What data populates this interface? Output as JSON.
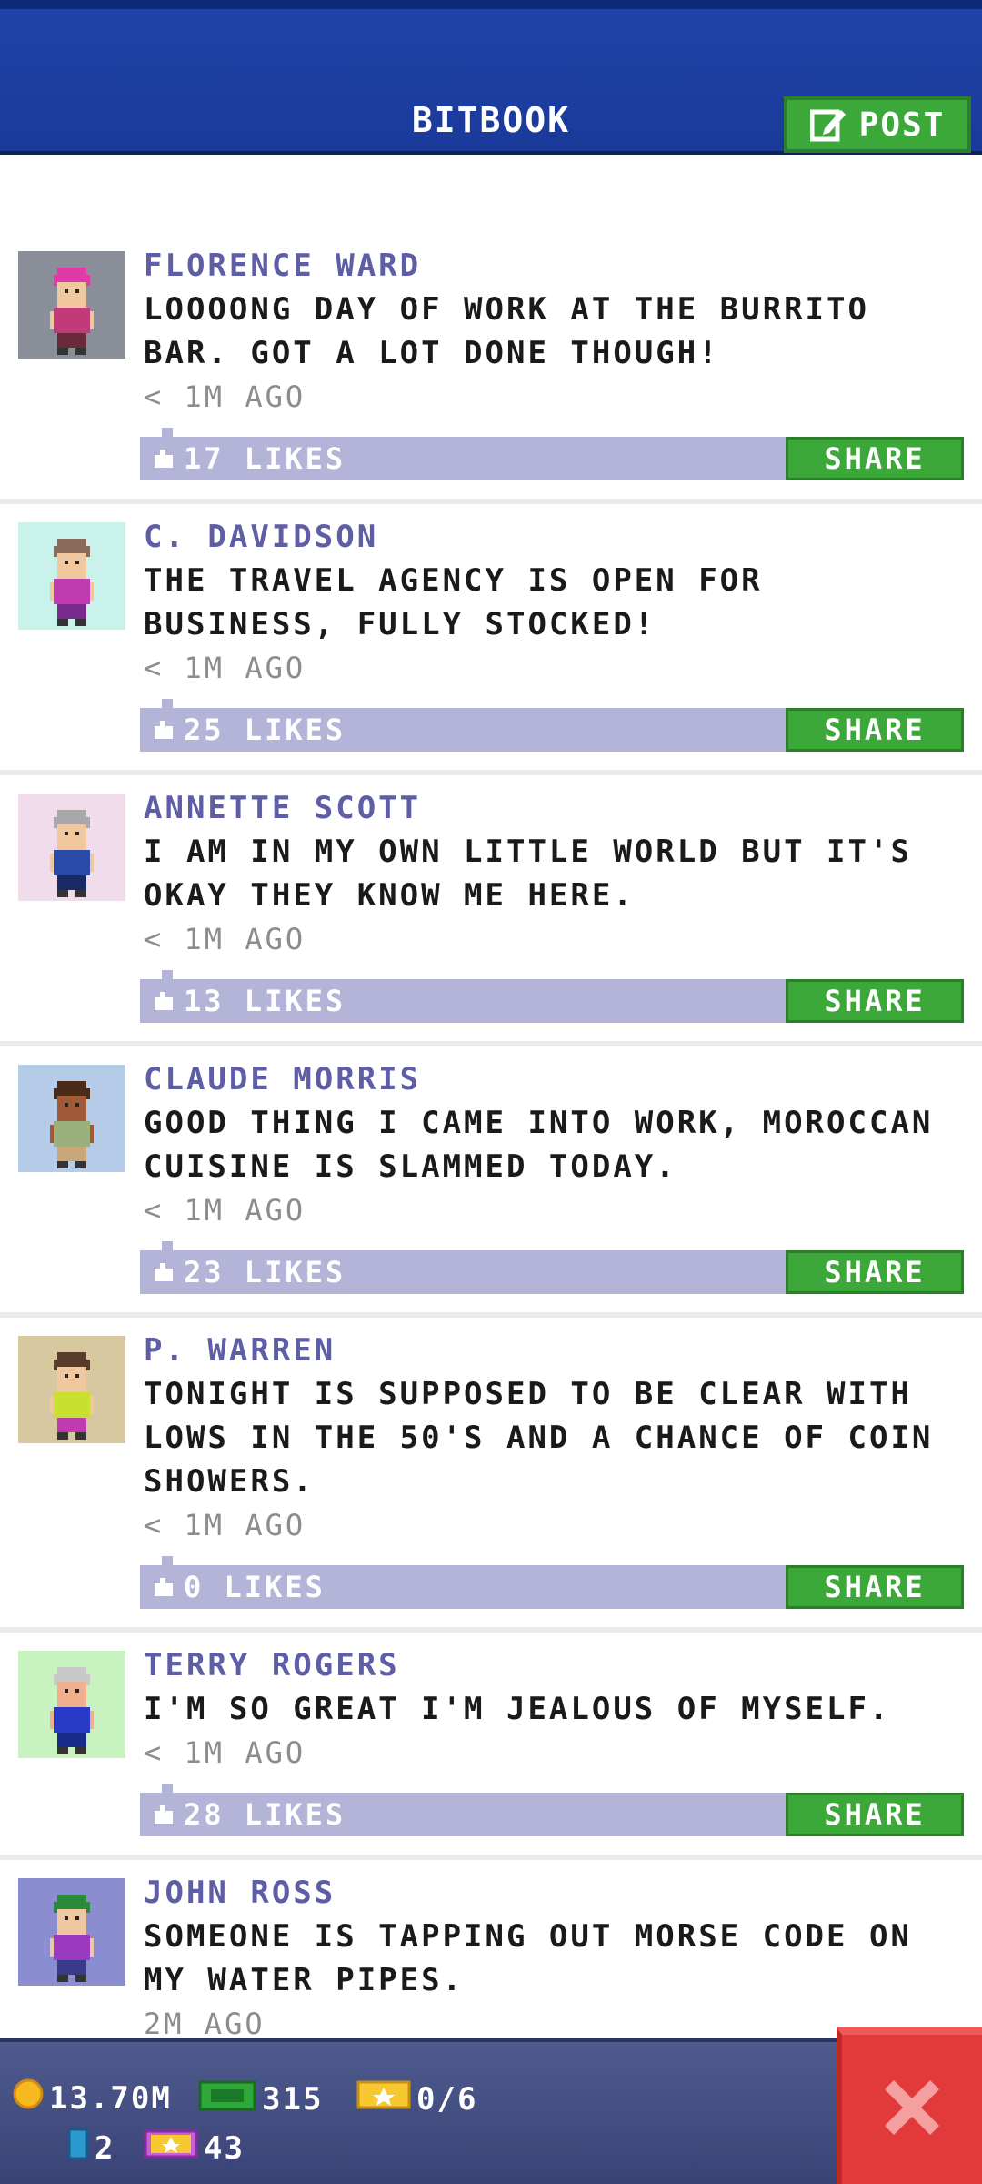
{
  "header": {
    "title": "BITBOOK",
    "post_label": "POST"
  },
  "posts": [
    {
      "author": "FLORENCE WARD",
      "text": "LOOOONG DAY OF WORK AT THE BURRITO BAR. GOT A LOT DONE THOUGH!",
      "time": "< 1M AGO",
      "likes": "17 LIKES",
      "share": "SHARE",
      "avatar_bg": "#8a8e98",
      "hair": "#e03aa8",
      "shirt": "#c23a7a",
      "pants": "#6a2a3a",
      "skin": "#f0c8a0"
    },
    {
      "author": "C. DAVIDSON",
      "text": "THE TRAVEL AGENCY IS OPEN FOR BUSINESS, FULLY STOCKED!",
      "time": "< 1M AGO",
      "likes": "25 LIKES",
      "share": "SHARE",
      "avatar_bg": "#c8f2ea",
      "hair": "#8a6a5a",
      "shirt": "#c03ab0",
      "pants": "#7a2a8a",
      "skin": "#f0c8a0"
    },
    {
      "author": "ANNETTE SCOTT",
      "text": "I AM IN MY OWN LITTLE WORLD BUT IT'S OKAY THEY KNOW ME HERE.",
      "time": "< 1M AGO",
      "likes": "13 LIKES",
      "share": "SHARE",
      "avatar_bg": "#f0dcea",
      "hair": "#a8a8a8",
      "shirt": "#2a4aa8",
      "pants": "#1a2a68",
      "skin": "#f0c8a0"
    },
    {
      "author": "CLAUDE MORRIS",
      "text": "GOOD THING I CAME INTO WORK, MOROCCAN CUISINE IS SLAMMED TODAY.",
      "time": "< 1M AGO",
      "likes": "23 LIKES",
      "share": "SHARE",
      "avatar_bg": "#b4cce8",
      "hair": "#4a2a18",
      "shirt": "#9ab07a",
      "pants": "#c8a878",
      "skin": "#a05a38"
    },
    {
      "author": "P. WARREN",
      "text": "TONIGHT IS SUPPOSED TO BE CLEAR WITH LOWS IN THE 50'S AND A CHANCE OF COIN SHOWERS.",
      "time": "< 1M AGO",
      "likes": "0 LIKES",
      "share": "SHARE",
      "avatar_bg": "#d8c8a0",
      "hair": "#5a3a28",
      "shirt": "#c8e030",
      "pants": "#c03ab0",
      "skin": "#f0c8a0"
    },
    {
      "author": "TERRY ROGERS",
      "text": "I'M SO GREAT I'M JEALOUS OF MYSELF.",
      "time": "< 1M AGO",
      "likes": "28 LIKES",
      "share": "SHARE",
      "avatar_bg": "#c8f2c0",
      "hair": "#c8c8c8",
      "shirt": "#2a3ac8",
      "pants": "#1a2a88",
      "skin": "#f0b090"
    },
    {
      "author": "JOHN ROSS",
      "text": "SOMEONE IS TAPPING OUT MORSE CODE ON MY WATER PIPES.",
      "time": "2M AGO",
      "likes": "",
      "share": "",
      "avatar_bg": "#8a8ed0",
      "hair": "#2a8a3a",
      "shirt": "#9a3ac0",
      "pants": "#3a3a8a",
      "skin": "#f0c8a0"
    }
  ],
  "bottom_bar": {
    "coins": "13.70M",
    "bux": "315",
    "tickets": "0/6",
    "elevators": "2",
    "vip": "43"
  },
  "colors": {
    "accent_green": "#3ca83a",
    "header_blue": "#1e43a8",
    "close_red": "#e23a3a"
  }
}
